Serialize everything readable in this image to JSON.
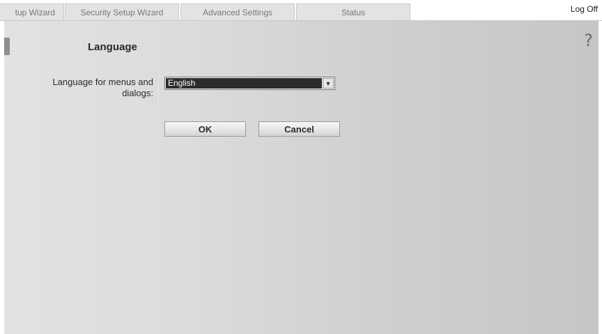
{
  "tabs": [
    {
      "label": "tup Wizard"
    },
    {
      "label": "Security Setup Wizard"
    },
    {
      "label": "Advanced Settings"
    },
    {
      "label": "Status"
    }
  ],
  "header": {
    "logoff_label": "Log Off"
  },
  "page": {
    "title": "Language",
    "help_icon": "?"
  },
  "form": {
    "language_label": "Language for menus and dialogs:",
    "language_value": "English",
    "dropdown_arrow": "▼"
  },
  "buttons": {
    "ok_label": "OK",
    "cancel_label": "Cancel"
  },
  "colors": {
    "content_left": "#e2e2e2",
    "content_right": "#c6c6c6",
    "tab_bg": "#e3e3e3",
    "selected_bg": "#2c2c2c"
  }
}
